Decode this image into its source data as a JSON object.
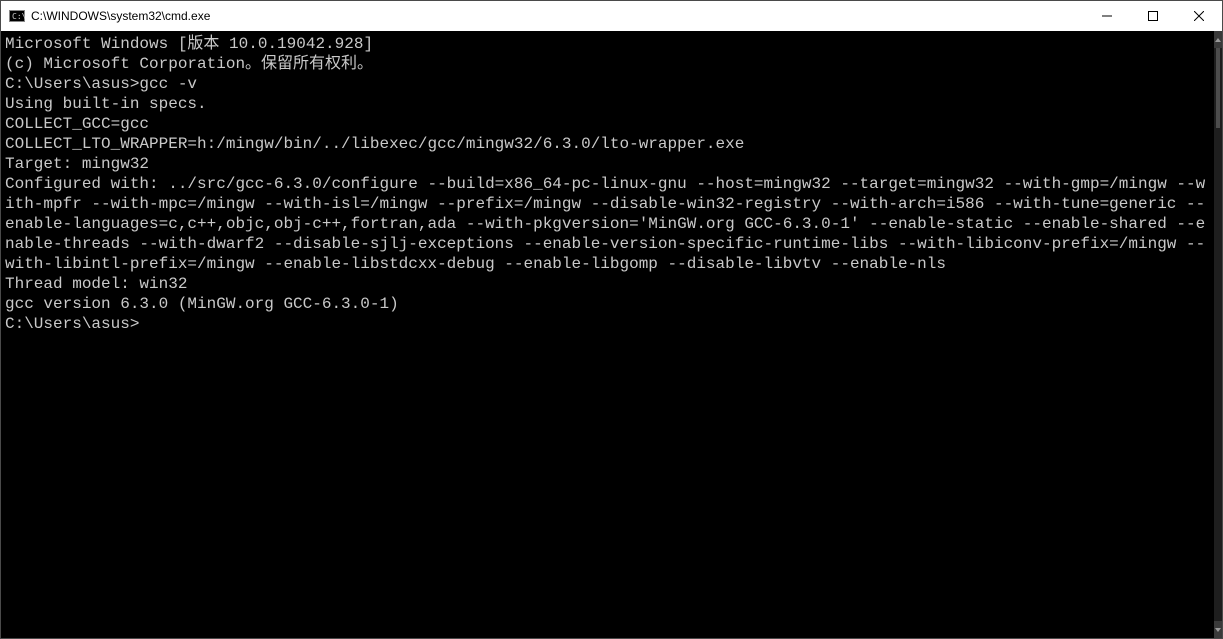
{
  "window": {
    "title": "C:\\WINDOWS\\system32\\cmd.exe"
  },
  "terminal": {
    "lines": [
      "Microsoft Windows [版本 10.0.19042.928]",
      "(c) Microsoft Corporation。保留所有权利。",
      "",
      "C:\\Users\\asus>gcc -v",
      "Using built-in specs.",
      "COLLECT_GCC=gcc",
      "COLLECT_LTO_WRAPPER=h:/mingw/bin/../libexec/gcc/mingw32/6.3.0/lto-wrapper.exe",
      "Target: mingw32",
      "Configured with: ../src/gcc-6.3.0/configure --build=x86_64-pc-linux-gnu --host=mingw32 --target=mingw32 --with-gmp=/mingw --with-mpfr --with-mpc=/mingw --with-isl=/mingw --prefix=/mingw --disable-win32-registry --with-arch=i586 --with-tune=generic --enable-languages=c,c++,objc,obj-c++,fortran,ada --with-pkgversion='MinGW.org GCC-6.3.0-1' --enable-static --enable-shared --enable-threads --with-dwarf2 --disable-sjlj-exceptions --enable-version-specific-runtime-libs --with-libiconv-prefix=/mingw --with-libintl-prefix=/mingw --enable-libstdcxx-debug --enable-libgomp --disable-libvtv --enable-nls",
      "Thread model: win32",
      "gcc version 6.3.0 (MinGW.org GCC-6.3.0-1)",
      "",
      "C:\\Users\\asus>"
    ]
  }
}
